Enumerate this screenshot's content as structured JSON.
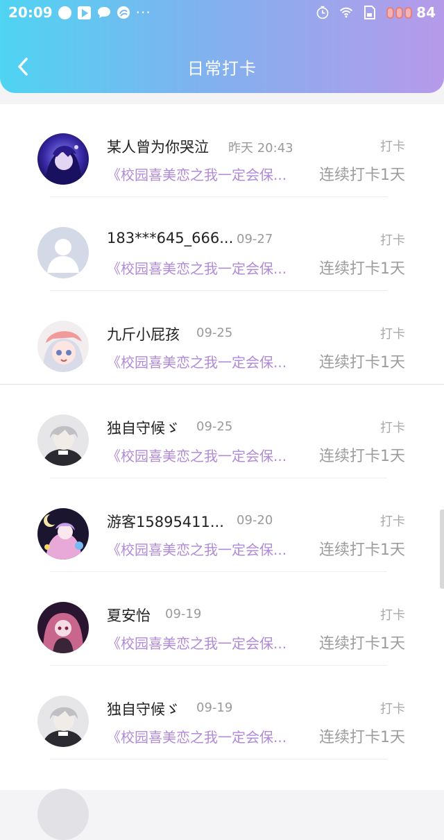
{
  "status_bar": {
    "time": "20:09",
    "more": "···",
    "battery_level": "84",
    "icons": [
      "chat-bubble-icon",
      "play-store-icon",
      "message-icon",
      "swirl-app-icon",
      "timer-icon",
      "wifi-icon",
      "sim-card-icon",
      "battery-icon"
    ]
  },
  "nav": {
    "title": "日常打卡",
    "back_icon": "chevron-left-icon"
  },
  "colors": {
    "header_gradient_start": "#4fd4f2",
    "header_gradient_end": "#b69aea",
    "book_link": "#b18ad8",
    "muted_text": "#9a9a9a"
  },
  "entries": [
    {
      "name": "某人曾为你哭泣",
      "date": "昨天 20:43",
      "tag": "打卡",
      "book": "《校园喜美恋之我一定会保...",
      "streak": "连续打卡1天"
    },
    {
      "name": "183***645_666...",
      "date": "09-27",
      "tag": "打卡",
      "book": "《校园喜美恋之我一定会保...",
      "streak": "连续打卡1天"
    },
    {
      "name": "九斤小屁孩",
      "date": "09-25",
      "tag": "打卡",
      "book": "《校园喜美恋之我一定会保...",
      "streak": "连续打卡1天"
    },
    {
      "name": "独自守候ゞ",
      "date": "09-25",
      "tag": "打卡",
      "book": "《校园喜美恋之我一定会保...",
      "streak": "连续打卡1天"
    },
    {
      "name": "游客15895411...",
      "date": "09-20",
      "tag": "打卡",
      "book": "《校园喜美恋之我一定会保...",
      "streak": "连续打卡1天"
    },
    {
      "name": "夏安怡",
      "date": "09-19",
      "tag": "打卡",
      "book": "《校园喜美恋之我一定会保...",
      "streak": "连续打卡1天"
    },
    {
      "name": "独自守候ゞ",
      "date": "09-19",
      "tag": "打卡",
      "book": "《校园喜美恋之我一定会保...",
      "streak": "连续打卡1天"
    }
  ]
}
